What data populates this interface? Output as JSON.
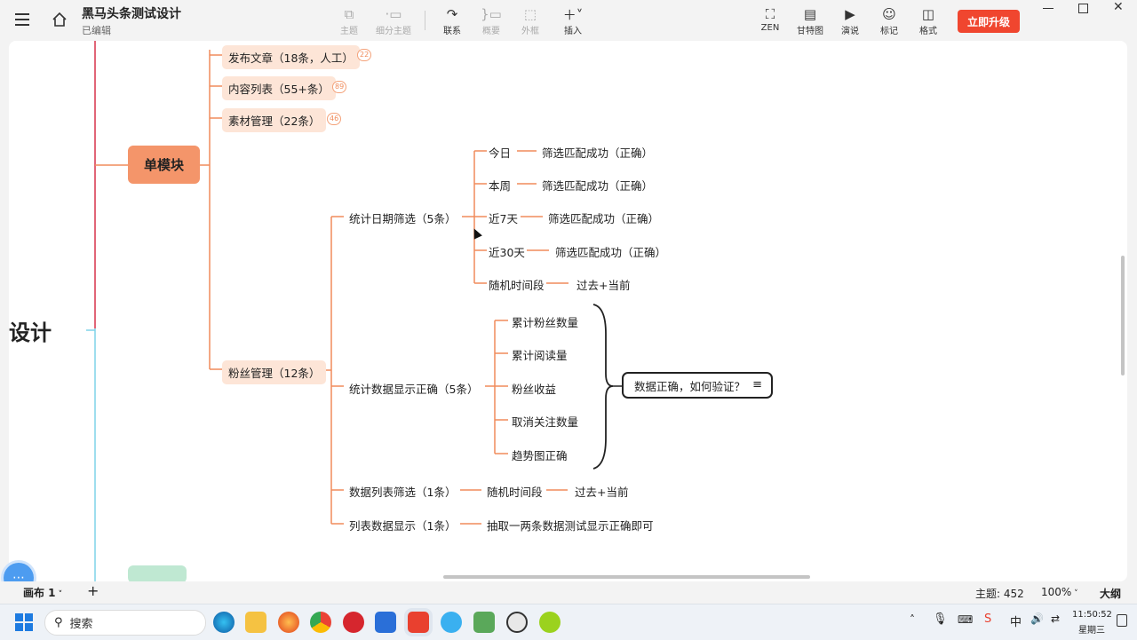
{
  "app": {
    "title": "黑马头条测试设计",
    "subtitle": "已编辑"
  },
  "toolbar": {
    "topic": "主题",
    "subtopic": "细分主题",
    "relation": "联系",
    "summary": "概要",
    "boundary": "外框",
    "insert": "插入",
    "zen": "ZEN",
    "gantt": "甘特图",
    "present": "演说",
    "mark": "标记",
    "format": "格式",
    "upgrade": "立即升级"
  },
  "mindmap": {
    "root_fragment": "设计",
    "single_module": "单模块",
    "module_children": [
      {
        "label": "发布文章（18条，人工）",
        "badge": "22"
      },
      {
        "label": "内容列表（55+条）",
        "badge": "89"
      },
      {
        "label": "素材管理（22条）",
        "badge": "46"
      },
      {
        "label": "粉丝管理（12条）"
      }
    ],
    "date_filter": {
      "label": "统计日期筛选（5条）",
      "items": [
        {
          "label": "今日",
          "result": "筛选匹配成功（正确）"
        },
        {
          "label": "本周",
          "result": "筛选匹配成功（正确）"
        },
        {
          "label": "近7天",
          "result": "筛选匹配成功（正确）"
        },
        {
          "label": "近30天",
          "result": "筛选匹配成功（正确）"
        },
        {
          "label": "随机时间段",
          "result": "过去+当前"
        }
      ]
    },
    "data_display": {
      "label": "统计数据显示正确（5条）",
      "items": [
        "累计粉丝数量",
        "累计阅读量",
        "粉丝收益",
        "取消关注数量",
        "趋势图正确"
      ],
      "summary": "数据正确，如何验证？"
    },
    "list_filter": {
      "label": "数据列表筛选（1条）",
      "child": "随机时间段",
      "result": "过去+当前"
    },
    "list_display": {
      "label": "列表数据显示（1条）",
      "child": "抽取一两条数据测试显示正确即可"
    }
  },
  "statusbar": {
    "sheet": "画布 1",
    "topics": "主题: 452",
    "zoom": "100%",
    "outline": "大纲"
  },
  "taskbar": {
    "search_placeholder": "搜索",
    "time": "11:50:52",
    "weekday": "星期三"
  },
  "colors": {
    "accent": "#f0462f",
    "branch": "#f08c5c",
    "single_module": "#f4956a",
    "root_line": "#d7324a",
    "blue_line": "#7fd3e8"
  }
}
